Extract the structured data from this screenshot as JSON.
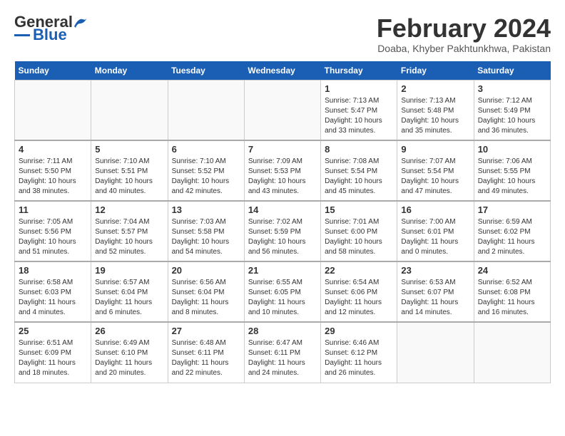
{
  "header": {
    "logo_line1": "General",
    "logo_line2": "Blue",
    "month": "February 2024",
    "location": "Doaba, Khyber Pakhtunkhwa, Pakistan"
  },
  "weekdays": [
    "Sunday",
    "Monday",
    "Tuesday",
    "Wednesday",
    "Thursday",
    "Friday",
    "Saturday"
  ],
  "weeks": [
    [
      {
        "day": "",
        "info": ""
      },
      {
        "day": "",
        "info": ""
      },
      {
        "day": "",
        "info": ""
      },
      {
        "day": "",
        "info": ""
      },
      {
        "day": "1",
        "info": "Sunrise: 7:13 AM\nSunset: 5:47 PM\nDaylight: 10 hours\nand 33 minutes."
      },
      {
        "day": "2",
        "info": "Sunrise: 7:13 AM\nSunset: 5:48 PM\nDaylight: 10 hours\nand 35 minutes."
      },
      {
        "day": "3",
        "info": "Sunrise: 7:12 AM\nSunset: 5:49 PM\nDaylight: 10 hours\nand 36 minutes."
      }
    ],
    [
      {
        "day": "4",
        "info": "Sunrise: 7:11 AM\nSunset: 5:50 PM\nDaylight: 10 hours\nand 38 minutes."
      },
      {
        "day": "5",
        "info": "Sunrise: 7:10 AM\nSunset: 5:51 PM\nDaylight: 10 hours\nand 40 minutes."
      },
      {
        "day": "6",
        "info": "Sunrise: 7:10 AM\nSunset: 5:52 PM\nDaylight: 10 hours\nand 42 minutes."
      },
      {
        "day": "7",
        "info": "Sunrise: 7:09 AM\nSunset: 5:53 PM\nDaylight: 10 hours\nand 43 minutes."
      },
      {
        "day": "8",
        "info": "Sunrise: 7:08 AM\nSunset: 5:54 PM\nDaylight: 10 hours\nand 45 minutes."
      },
      {
        "day": "9",
        "info": "Sunrise: 7:07 AM\nSunset: 5:54 PM\nDaylight: 10 hours\nand 47 minutes."
      },
      {
        "day": "10",
        "info": "Sunrise: 7:06 AM\nSunset: 5:55 PM\nDaylight: 10 hours\nand 49 minutes."
      }
    ],
    [
      {
        "day": "11",
        "info": "Sunrise: 7:05 AM\nSunset: 5:56 PM\nDaylight: 10 hours\nand 51 minutes."
      },
      {
        "day": "12",
        "info": "Sunrise: 7:04 AM\nSunset: 5:57 PM\nDaylight: 10 hours\nand 52 minutes."
      },
      {
        "day": "13",
        "info": "Sunrise: 7:03 AM\nSunset: 5:58 PM\nDaylight: 10 hours\nand 54 minutes."
      },
      {
        "day": "14",
        "info": "Sunrise: 7:02 AM\nSunset: 5:59 PM\nDaylight: 10 hours\nand 56 minutes."
      },
      {
        "day": "15",
        "info": "Sunrise: 7:01 AM\nSunset: 6:00 PM\nDaylight: 10 hours\nand 58 minutes."
      },
      {
        "day": "16",
        "info": "Sunrise: 7:00 AM\nSunset: 6:01 PM\nDaylight: 11 hours\nand 0 minutes."
      },
      {
        "day": "17",
        "info": "Sunrise: 6:59 AM\nSunset: 6:02 PM\nDaylight: 11 hours\nand 2 minutes."
      }
    ],
    [
      {
        "day": "18",
        "info": "Sunrise: 6:58 AM\nSunset: 6:03 PM\nDaylight: 11 hours\nand 4 minutes."
      },
      {
        "day": "19",
        "info": "Sunrise: 6:57 AM\nSunset: 6:04 PM\nDaylight: 11 hours\nand 6 minutes."
      },
      {
        "day": "20",
        "info": "Sunrise: 6:56 AM\nSunset: 6:04 PM\nDaylight: 11 hours\nand 8 minutes."
      },
      {
        "day": "21",
        "info": "Sunrise: 6:55 AM\nSunset: 6:05 PM\nDaylight: 11 hours\nand 10 minutes."
      },
      {
        "day": "22",
        "info": "Sunrise: 6:54 AM\nSunset: 6:06 PM\nDaylight: 11 hours\nand 12 minutes."
      },
      {
        "day": "23",
        "info": "Sunrise: 6:53 AM\nSunset: 6:07 PM\nDaylight: 11 hours\nand 14 minutes."
      },
      {
        "day": "24",
        "info": "Sunrise: 6:52 AM\nSunset: 6:08 PM\nDaylight: 11 hours\nand 16 minutes."
      }
    ],
    [
      {
        "day": "25",
        "info": "Sunrise: 6:51 AM\nSunset: 6:09 PM\nDaylight: 11 hours\nand 18 minutes."
      },
      {
        "day": "26",
        "info": "Sunrise: 6:49 AM\nSunset: 6:10 PM\nDaylight: 11 hours\nand 20 minutes."
      },
      {
        "day": "27",
        "info": "Sunrise: 6:48 AM\nSunset: 6:11 PM\nDaylight: 11 hours\nand 22 minutes."
      },
      {
        "day": "28",
        "info": "Sunrise: 6:47 AM\nSunset: 6:11 PM\nDaylight: 11 hours\nand 24 minutes."
      },
      {
        "day": "29",
        "info": "Sunrise: 6:46 AM\nSunset: 6:12 PM\nDaylight: 11 hours\nand 26 minutes."
      },
      {
        "day": "",
        "info": ""
      },
      {
        "day": "",
        "info": ""
      }
    ]
  ]
}
